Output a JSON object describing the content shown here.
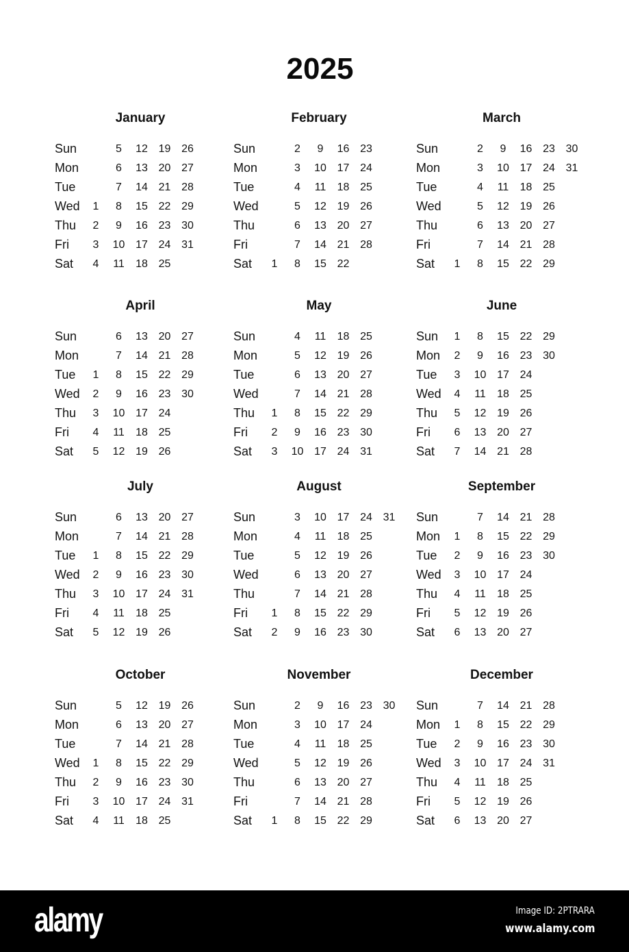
{
  "title": "2025",
  "day_labels": [
    "Sun",
    "Mon",
    "Tue",
    "Wed",
    "Thu",
    "Fri",
    "Sat"
  ],
  "months": [
    {
      "name": "January",
      "first_weekday": 3,
      "days": 31
    },
    {
      "name": "February",
      "first_weekday": 6,
      "days": 28
    },
    {
      "name": "March",
      "first_weekday": 6,
      "days": 31
    },
    {
      "name": "April",
      "first_weekday": 2,
      "days": 30
    },
    {
      "name": "May",
      "first_weekday": 4,
      "days": 31
    },
    {
      "name": "June",
      "first_weekday": 0,
      "days": 30
    },
    {
      "name": "July",
      "first_weekday": 2,
      "days": 31
    },
    {
      "name": "August",
      "first_weekday": 5,
      "days": 31
    },
    {
      "name": "September",
      "first_weekday": 1,
      "days": 30
    },
    {
      "name": "October",
      "first_weekday": 3,
      "days": 31
    },
    {
      "name": "November",
      "first_weekday": 6,
      "days": 30
    },
    {
      "name": "December",
      "first_weekday": 1,
      "days": 31
    }
  ],
  "footer": {
    "logo": "alamy",
    "image_id": "Image ID: 2PTRARA",
    "website": "www.alamy.com"
  }
}
